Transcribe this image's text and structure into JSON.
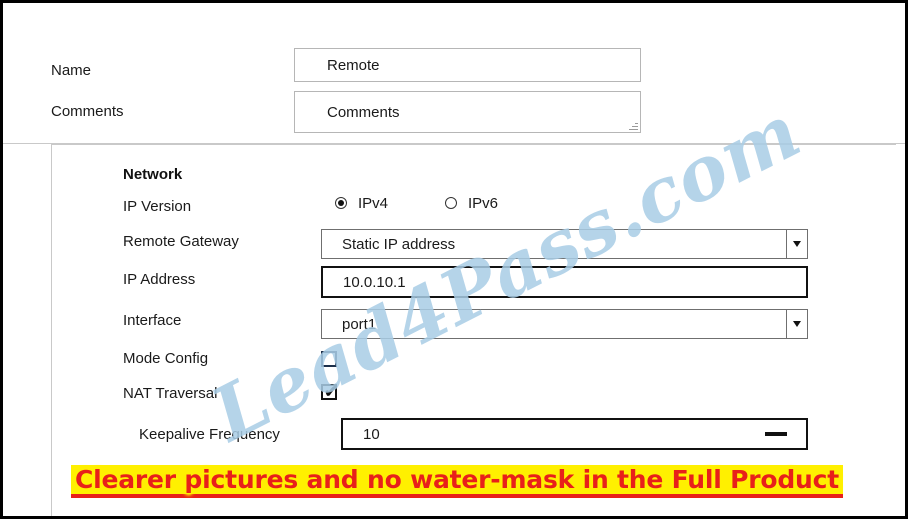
{
  "watermark": {
    "text": "Lead4Pass.com"
  },
  "form": {
    "name": {
      "label": "Name",
      "value": "Remote"
    },
    "comments": {
      "label": "Comments",
      "value": "Comments"
    }
  },
  "network": {
    "title": "Network",
    "ip_version": {
      "label": "IP Version",
      "options": [
        {
          "label": "IPv4",
          "selected": true
        },
        {
          "label": "IPv6",
          "selected": false
        }
      ]
    },
    "remote_gateway": {
      "label": "Remote Gateway",
      "value": "Static IP address",
      "arrow_icon": "chevron-down-icon"
    },
    "ip_address": {
      "label": "IP Address",
      "value": "10.0.10.1"
    },
    "interface": {
      "label": "Interface",
      "value": "port1",
      "arrow_icon": "chevron-down-icon"
    },
    "mode_config": {
      "label": "Mode Config",
      "checked": false
    },
    "nat_traversal": {
      "label": "NAT Traversal",
      "checked": true,
      "check_glyph": "✔"
    },
    "keepalive_frequency": {
      "label": "Keepalive Frequency",
      "value": "10",
      "stepper_icon": "minus-icon"
    }
  },
  "banner": {
    "text": "Clearer pictures and no water-mask in the Full Product",
    "text_color": "#e8201a",
    "highlight_color": "#fff000"
  }
}
